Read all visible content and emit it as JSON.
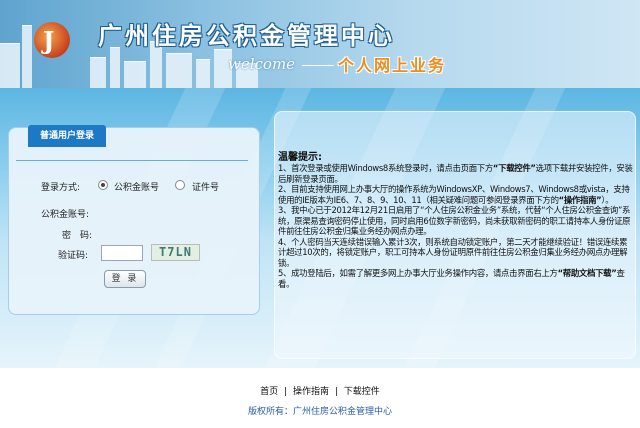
{
  "header": {
    "logo_text": "J",
    "title": "广州住房公积金管理中心",
    "welcome": "welcome",
    "subtitle": "个人网上业务"
  },
  "login": {
    "tab_label": "普通用户登录",
    "login_mode_label": "登录方式:",
    "options": [
      "公积金账号",
      "证件号"
    ],
    "selected_option": "公积金账号",
    "account_label": "公积金账号:",
    "password_label": "密　码:",
    "captcha_label": "验证码:",
    "captcha_value": "",
    "captcha_image_text": "T7LN",
    "login_button": "登 录"
  },
  "tips": {
    "title": "温馨提示:",
    "items": [
      {
        "pre": "1、首次登录或使用Windows8系统登录时，请点击页面下方",
        "bold": "“下载控件”",
        "post": "选项下载并安装控件，安装后刷新登录页面。"
      },
      {
        "pre": "2、目前支持使用网上办事大厅的操作系统为WindowsXP、Windows7、Windows8或vista，支持使用的IE版本为IE6、7、8、9、10、11（相关疑难问题可参阅登录界面下方的",
        "bold": "“操作指南”",
        "post": "）。"
      },
      {
        "pre": "3、我中心已于2012年12月21日启用了“个人住房公积金业务”系统，代替“个人住房公积金查询”系统，原渠易查询密码停止使用，同时启用6位数字新密码，尚未获取新密码的职工请持本人身份证原件前往住房公积金归集业务经办网点办理。",
        "bold": "",
        "post": ""
      },
      {
        "pre": "4、个人密码当天连续错误输入累计3次，则系统自动锁定账户，第二天才能继续验证！错误连续累计超过10次的，将锁定账户，职工可持本人身份证明原件前往住房公积金归集业务经办网点办理解锁。",
        "bold": "",
        "post": ""
      },
      {
        "pre": "5、成功登陆后，如需了解更多网上办事大厅业务操作内容，请点击界面右上方",
        "bold": "“帮助文档下载”",
        "post": "查看。"
      }
    ]
  },
  "footer": {
    "links": [
      "首页",
      "操作指南",
      "下载控件"
    ],
    "separator": "|",
    "copyright": "版权所有：广州住房公积金管理中心"
  }
}
